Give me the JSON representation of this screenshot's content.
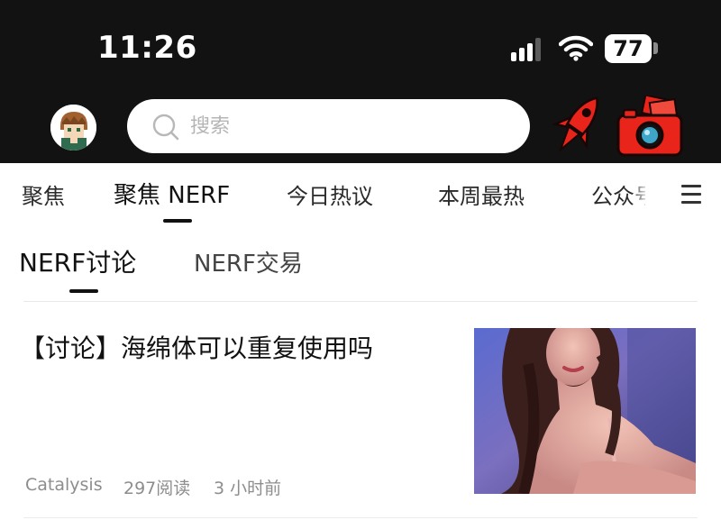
{
  "status_bar": {
    "time": "11:26",
    "battery_level": "77",
    "signal_icon": "signal-bars-icon",
    "wifi_icon": "wifi-icon"
  },
  "header": {
    "avatar_icon": "user-avatar",
    "search": {
      "placeholder": "搜索",
      "value": ""
    },
    "rocket_icon": "rocket-icon",
    "camera_icon": "camera-icon"
  },
  "channels": {
    "items": [
      {
        "label": "聚焦"
      },
      {
        "label": "聚焦 NERF"
      },
      {
        "label": "今日热议"
      },
      {
        "label": "本周最热"
      },
      {
        "label": "公众号"
      }
    ],
    "active_index": 1,
    "menu_icon": "hamburger-menu-icon"
  },
  "sub_tabs": {
    "items": [
      {
        "label": "NERF讨论"
      },
      {
        "label": "NERF交易"
      }
    ],
    "active_index": 0
  },
  "article": {
    "title": "【讨论】海绵体可以重复使用吗",
    "author": "Catalysis",
    "reads": "297阅读",
    "time_ago": "3 小时前",
    "thumbnail": "photo-thumbnail"
  },
  "colors": {
    "header_bg": "#121212",
    "accent_red": "#e8241b",
    "text_primary": "#111111",
    "text_meta": "#8d8d8d"
  }
}
